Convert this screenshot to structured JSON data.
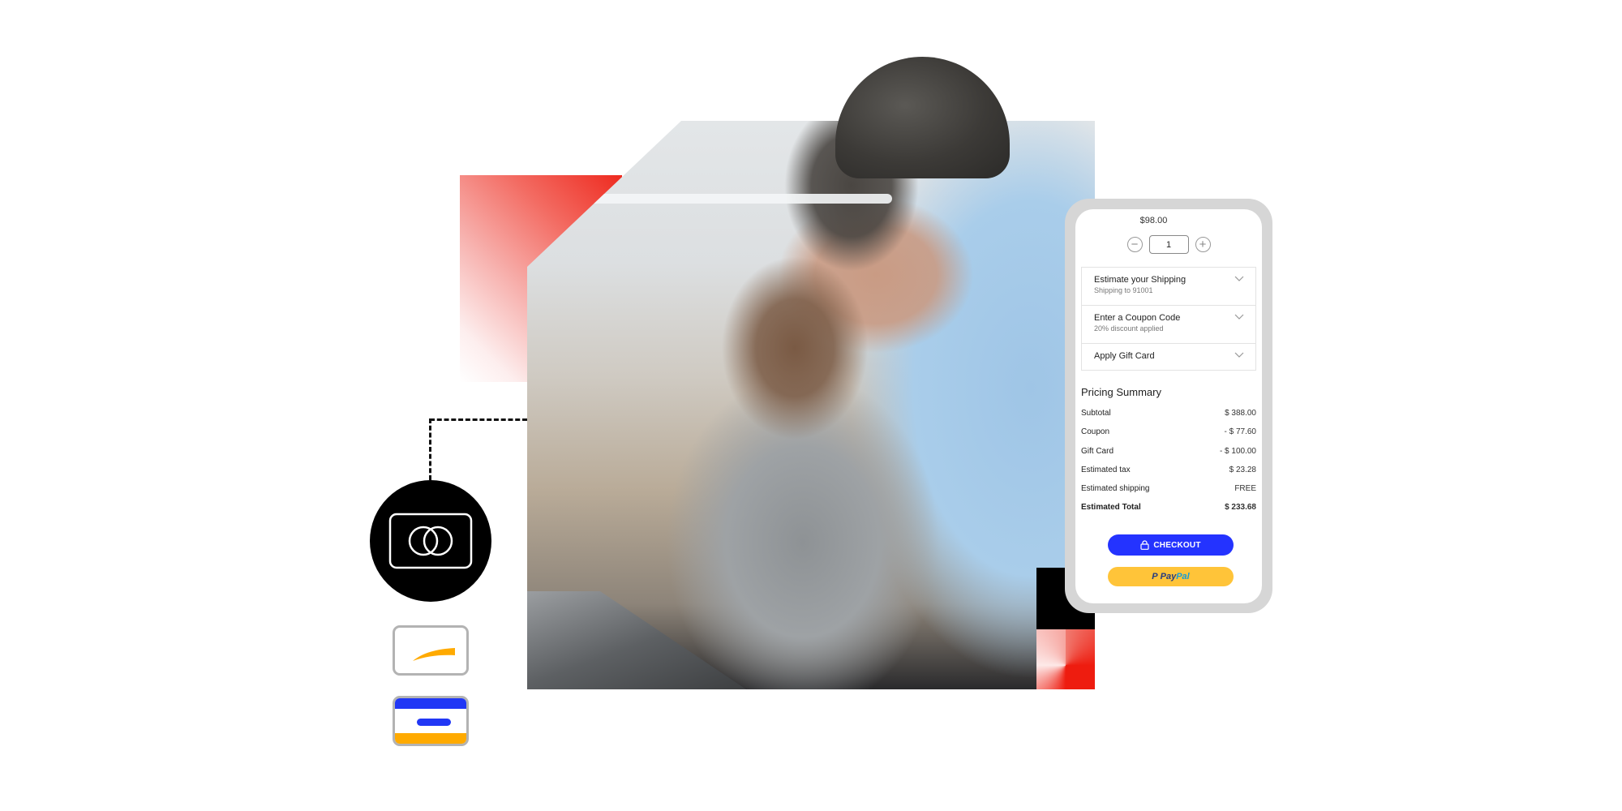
{
  "scene": {
    "colors": {
      "brand_blue": "#2433ff",
      "paypal_yellow": "#ffc439",
      "accent_red": "#ee1c0f",
      "card_orange": "#ffaa00"
    },
    "icons": {
      "payment_circle": "mastercard-outline-icon",
      "card1": "card-swoosh-icon",
      "card2": "card-striped-icon"
    }
  },
  "phone": {
    "item_price": "$98.00",
    "quantity": {
      "value": "1",
      "decrement_icon": "minus-circle-icon",
      "increment_icon": "plus-circle-icon",
      "decrement_glyph": "−",
      "increment_glyph": "+"
    },
    "accordion": [
      {
        "title": "Estimate your Shipping",
        "subtitle": "Shipping to 91001"
      },
      {
        "title": "Enter a Coupon Code",
        "subtitle": "20% discount applied"
      },
      {
        "title": "Apply Gift Card",
        "subtitle": ""
      }
    ],
    "pricing_summary": {
      "title": "Pricing Summary",
      "rows": [
        {
          "label": "Subtotal",
          "value": "$ 388.00"
        },
        {
          "label": "Coupon",
          "value": "- $ 77.60"
        },
        {
          "label": "Gift Card",
          "value": "- $ 100.00"
        },
        {
          "label": "Estimated tax",
          "value": "$ 23.28"
        },
        {
          "label": "Estimated shipping",
          "value": "FREE"
        },
        {
          "label": "Estimated Total",
          "value": "$ 233.68"
        }
      ]
    },
    "checkout_label": "CHECKOUT",
    "paypal": {
      "part1": "Pay",
      "part2": "Pal",
      "mark": "P"
    }
  }
}
